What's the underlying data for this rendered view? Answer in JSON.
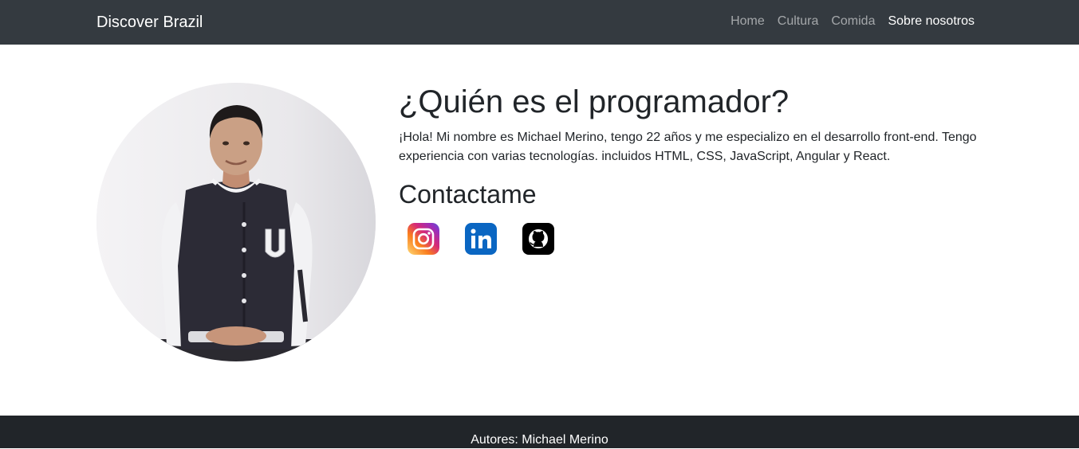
{
  "navbar": {
    "brand": "Discover Brazil",
    "links": [
      {
        "label": "Home",
        "active": false
      },
      {
        "label": "Cultura",
        "active": false
      },
      {
        "label": "Comida",
        "active": false
      },
      {
        "label": "Sobre nosotros",
        "active": true
      }
    ]
  },
  "profile": {
    "photo_icon": "person-photo"
  },
  "about": {
    "title": "¿Quién es el programador?",
    "bio": "¡Hola! Mi nombre es Michael Merino, tengo 22 años y me especializo en el desarrollo front-end. Tengo experiencia con varias tecnologías. incluidos HTML, CSS, JavaScript, Angular y React.",
    "contact_title": "Contactame"
  },
  "socials": [
    {
      "icon": "instagram-icon",
      "color": "#e1306c"
    },
    {
      "icon": "linkedin-icon",
      "color": "#0a66c2"
    },
    {
      "icon": "github-icon",
      "color": "#000000"
    }
  ],
  "colors": {
    "navbar_bg": "#343a40",
    "footer_bg": "#212529"
  },
  "footer": {
    "text": "Autores: Michael Merino"
  }
}
